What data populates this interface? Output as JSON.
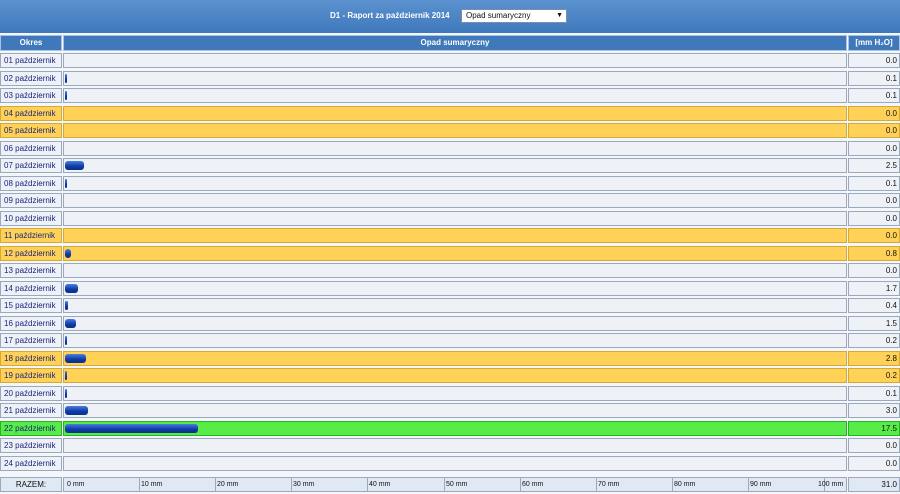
{
  "header": {
    "title": "D1 - Raport za październik 2014",
    "select_value": "Opad sumaryczny"
  },
  "columns": {
    "period": "Okres",
    "series": "Opad sumaryczny",
    "unit": "[mm H₂O]"
  },
  "footer": {
    "label": "RAZEM:",
    "total": "31.0"
  },
  "colors": {
    "holiday_row": "#ffd257",
    "today_row": "#58ec48",
    "bar": "#0d3aa3",
    "header": "#3f78bb"
  },
  "chart_data": {
    "type": "bar",
    "orientation": "horizontal",
    "categories": [
      "01 październik",
      "02 październik",
      "03 październik",
      "04 październik",
      "05 październik",
      "06 październik",
      "07 październik",
      "08 październik",
      "09 październik",
      "10 październik",
      "11 październik",
      "12 październik",
      "13 październik",
      "14 październik",
      "15 październik",
      "16 październik",
      "17 październik",
      "18 październik",
      "19 październik",
      "20 październik",
      "21 październik",
      "22 październik",
      "23 październik",
      "24 październik"
    ],
    "values": [
      0.0,
      0.1,
      0.1,
      0.0,
      0.0,
      0.0,
      2.5,
      0.1,
      0.0,
      0.0,
      0.0,
      0.8,
      0.0,
      1.7,
      0.4,
      1.5,
      0.2,
      2.8,
      0.2,
      0.1,
      3.0,
      17.5,
      0.0,
      0.0
    ],
    "value_labels": [
      "0.0",
      "0.1",
      "0.1",
      "0.0",
      "0.0",
      "0.0",
      "2.5",
      "0.1",
      "0.0",
      "0.0",
      "0.0",
      "0.8",
      "0.0",
      "1.7",
      "0.4",
      "1.5",
      "0.2",
      "2.8",
      "0.2",
      "0.1",
      "3.0",
      "17.5",
      "0.0",
      "0.0"
    ],
    "highlight": [
      "",
      "",
      "",
      "holiday",
      "holiday",
      "",
      "",
      "",
      "",
      "",
      "holiday",
      "holiday",
      "",
      "",
      "",
      "",
      "",
      "holiday",
      "holiday",
      "",
      "",
      "today",
      "",
      ""
    ],
    "xlim": [
      0,
      100
    ],
    "xticks": [
      0,
      10,
      20,
      30,
      40,
      50,
      60,
      70,
      80,
      90,
      100
    ],
    "xtick_labels": [
      "0 mm",
      "10 mm",
      "20 mm",
      "30 mm",
      "40 mm",
      "50 mm",
      "60 mm",
      "70 mm",
      "80 mm",
      "90 mm",
      "100 mm"
    ],
    "title": "",
    "xlabel": "",
    "ylabel": ""
  }
}
